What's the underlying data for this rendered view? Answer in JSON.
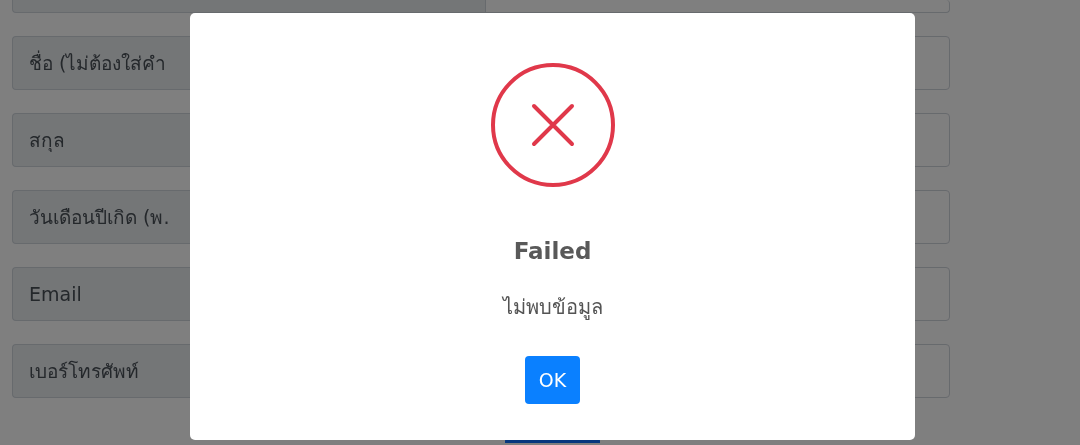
{
  "form": {
    "rows": [
      {
        "label": "ชื่อ (ไม่ต้องใส่คำ"
      },
      {
        "label": "สกุล"
      },
      {
        "label": "วันเดือนปีเกิด (พ."
      },
      {
        "label": "Email"
      },
      {
        "label": "เบอร์โทรศัพท์"
      }
    ]
  },
  "dialog": {
    "kind": "error",
    "title": "Failed",
    "message": "ไม่พบข้อมูล",
    "button": "OK"
  }
}
